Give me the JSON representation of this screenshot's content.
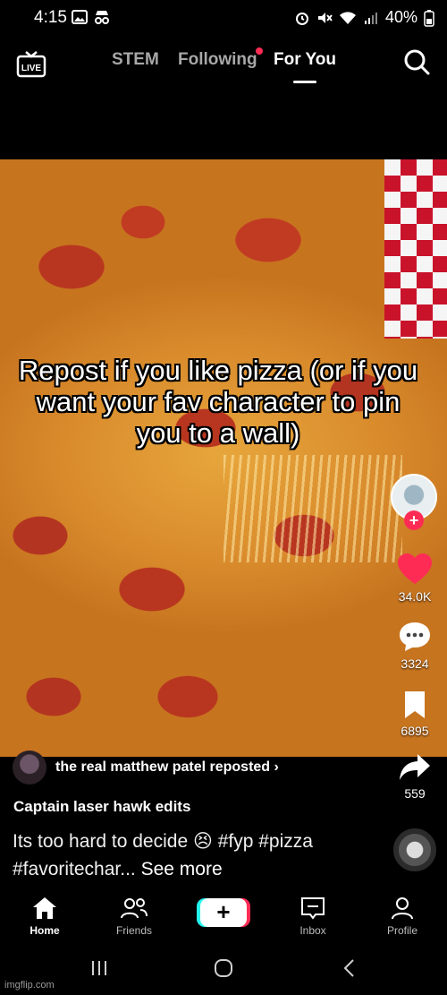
{
  "status_bar": {
    "time": "4:15",
    "battery": "40%",
    "left_icons": [
      "gallery-icon",
      "incognito-icon"
    ],
    "right_icons": [
      "alarm-icon",
      "mute-icon",
      "wifi-icon",
      "signal-icon",
      "battery-icon"
    ]
  },
  "top_nav": {
    "live_label": "LIVE",
    "tabs": [
      {
        "label": "STEM",
        "active": false
      },
      {
        "label": "Following",
        "active": false,
        "has_dot": true
      },
      {
        "label": "For You",
        "active": true
      }
    ]
  },
  "video": {
    "caption": "Repost if you like pizza (or if you want your fav character to pin you to a wall)"
  },
  "rail": {
    "likes": "34.0K",
    "comments": "3324",
    "saves": "6895",
    "shares": "559"
  },
  "post": {
    "repost_text": "the real matthew patel reposted",
    "repost_chevron": "›",
    "author": "Captain laser hawk edits",
    "description": "Its too hard to decide 😣 #fyp #pizza #favoritechar...",
    "see_more": "See more"
  },
  "bottom_nav": {
    "items": [
      {
        "label": "Home",
        "active": true
      },
      {
        "label": "Friends",
        "active": false
      },
      {
        "label": "Inbox",
        "active": false
      },
      {
        "label": "Profile",
        "active": false
      }
    ],
    "create_symbol": "+"
  },
  "watermark": "imgflip.com",
  "colors": {
    "accent": "#fe2c55",
    "cyan": "#25f4ee",
    "background": "#000000"
  }
}
